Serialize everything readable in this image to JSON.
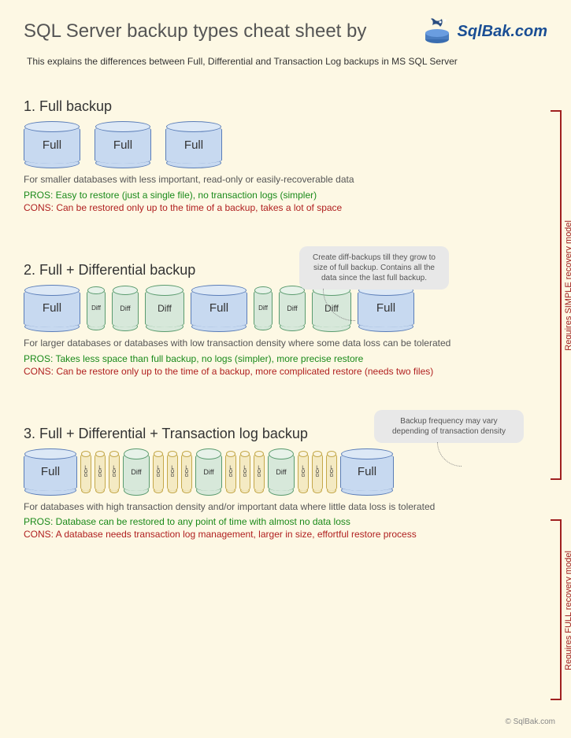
{
  "header": {
    "title": "SQL Server backup types cheat sheet by",
    "brand": "SqlBak.com"
  },
  "subtitle": "This explains the differences between Full, Differential and Transaction Log backups in MS SQL Server",
  "labels": {
    "full": "Full",
    "diff": "Diff",
    "log": "LOG"
  },
  "section1": {
    "heading": "1. Full backup",
    "desc": "For smaller databases with less important, read-only or easily-recoverable data",
    "pros": "PROS: Easy to restore (just a single file), no transaction logs (simpler)",
    "cons": "CONS: Can be restored only up to the time of a backup, takes a lot of space"
  },
  "section2": {
    "heading": "2. Full + Differential backup",
    "callout": "Create diff-backups till they grow to size of full backup. Contains all the data since the last full backup.",
    "desc": "For larger databases or databases with low transaction density where some data loss can be tolerated",
    "pros": "PROS: Takes less space than full backup, no logs (simpler), more precise restore",
    "cons": "CONS: Can be restore only up to the time of a backup, more complicated restore (needs two files)"
  },
  "section3": {
    "heading": "3. Full + Differential + Transaction log backup",
    "callout": "Backup frequency may vary depending of transaction density",
    "desc": "For databases with high transaction density and/or important data where little data loss is tolerated",
    "pros": "PROS: Database can be restored to any point of time with almost no data loss",
    "cons": "CONS: A database needs transaction log management, larger in size, effortful restore process"
  },
  "brackets": {
    "simple": "Requires SIMPLE recovery model",
    "full": "Requires FULL recovery model"
  },
  "footer": "© SqlBak.com"
}
